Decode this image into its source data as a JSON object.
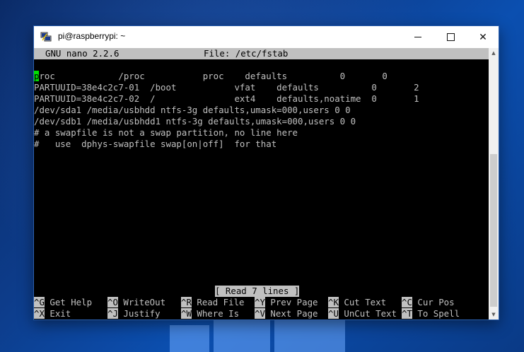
{
  "window": {
    "title": "pi@raspberrypi: ~",
    "minimize_icon": "minimize-icon",
    "maximize_icon": "maximize-icon",
    "close_label": "✕"
  },
  "nano": {
    "version": "GNU nano 2.2.6",
    "file": "File: /etc/fstab",
    "cursor_char": "p",
    "lines": [
      "roc            /proc           proc    defaults          0       0",
      "PARTUUID=38e4c2c7-01  /boot           vfat    defaults          0       2",
      "PARTUUID=38e4c2c7-02  /               ext4    defaults,noatime  0       1",
      "/dev/sda1 /media/usbhdd ntfs-3g defaults,umask=000,users 0 0",
      "/dev/sdb1 /media/usbhdd1 ntfs-3g defaults,umask=000,users 0 0",
      "# a swapfile is not a swap partition, no line here",
      "#   use  dphys-swapfile swap[on|off]  for that"
    ],
    "status": "[ Read 7 lines ]",
    "shortcuts_row1": [
      {
        "key": "^G",
        "label": " Get Help"
      },
      {
        "key": "^O",
        "label": " WriteOut"
      },
      {
        "key": "^R",
        "label": " Read File"
      },
      {
        "key": "^Y",
        "label": " Prev Page"
      },
      {
        "key": "^K",
        "label": " Cut Text"
      },
      {
        "key": "^C",
        "label": " Cur Pos"
      }
    ],
    "shortcuts_row2": [
      {
        "key": "^X",
        "label": " Exit"
      },
      {
        "key": "^J",
        "label": " Justify"
      },
      {
        "key": "^W",
        "label": " Where Is"
      },
      {
        "key": "^V",
        "label": " Next Page"
      },
      {
        "key": "^U",
        "label": " UnCut Text"
      },
      {
        "key": "^T",
        "label": " To Spell"
      }
    ]
  },
  "colors": {
    "terminal_bg": "#000000",
    "terminal_fg": "#c0c0c0",
    "cursor": "#00e000",
    "desktop": "#0b4fb0"
  }
}
